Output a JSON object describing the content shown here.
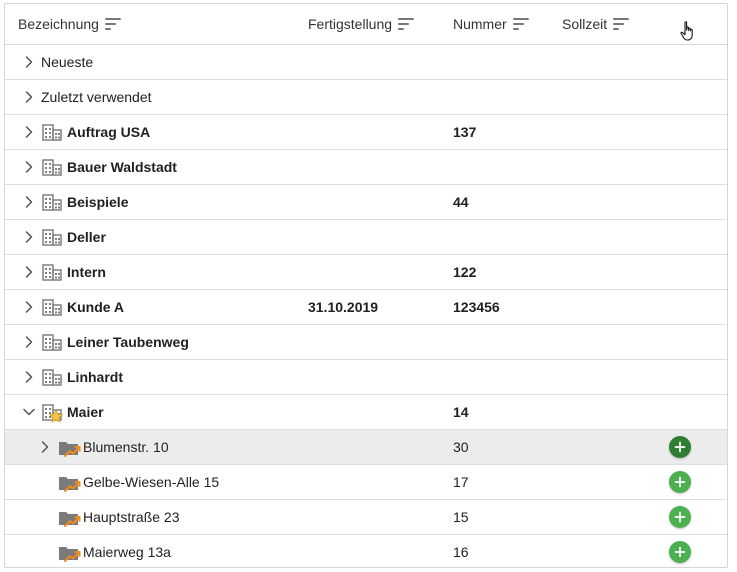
{
  "columns": [
    {
      "key": "bezeichnung",
      "label": "Bezeichnung"
    },
    {
      "key": "fertigstellung",
      "label": "Fertigstellung"
    },
    {
      "key": "nummer",
      "label": "Nummer"
    },
    {
      "key": "sollzeit",
      "label": "Sollzeit"
    }
  ],
  "rows": [
    {
      "id": "neueste",
      "name": "Neueste",
      "level": 0,
      "expand": "collapsed",
      "icon": "none",
      "bold": false,
      "date": "",
      "number": "",
      "add": false
    },
    {
      "id": "zuletzt",
      "name": "Zuletzt verwendet",
      "level": 0,
      "expand": "collapsed",
      "icon": "none",
      "bold": false,
      "date": "",
      "number": "",
      "add": false
    },
    {
      "id": "auftrag-usa",
      "name": "Auftrag USA",
      "level": 0,
      "expand": "collapsed",
      "icon": "building-icon",
      "bold": true,
      "date": "",
      "number": "137",
      "add": false
    },
    {
      "id": "bauer-waldstadt",
      "name": "Bauer Waldstadt",
      "level": 0,
      "expand": "collapsed",
      "icon": "building-icon",
      "bold": true,
      "date": "",
      "number": "",
      "add": false
    },
    {
      "id": "beispiele",
      "name": "Beispiele",
      "level": 0,
      "expand": "collapsed",
      "icon": "building-icon",
      "bold": true,
      "date": "",
      "number": "44",
      "add": false
    },
    {
      "id": "deller",
      "name": "Deller",
      "level": 0,
      "expand": "collapsed",
      "icon": "building-icon",
      "bold": true,
      "date": "",
      "number": "",
      "add": false
    },
    {
      "id": "intern",
      "name": "Intern",
      "level": 0,
      "expand": "collapsed",
      "icon": "building-icon",
      "bold": true,
      "date": "",
      "number": "122",
      "add": false
    },
    {
      "id": "kunde-a",
      "name": "Kunde A",
      "level": 0,
      "expand": "collapsed",
      "icon": "building-icon",
      "bold": true,
      "date": "31.10.2019",
      "number": "123456",
      "add": false
    },
    {
      "id": "leiner",
      "name": "Leiner Taubenweg",
      "level": 0,
      "expand": "collapsed",
      "icon": "building-icon",
      "bold": true,
      "date": "",
      "number": "",
      "add": false
    },
    {
      "id": "linhardt",
      "name": "Linhardt",
      "level": 0,
      "expand": "collapsed",
      "icon": "building-icon",
      "bold": true,
      "date": "",
      "number": "",
      "add": false
    },
    {
      "id": "maier",
      "name": "Maier",
      "level": 0,
      "expand": "expanded",
      "icon": "building-star-icon",
      "bold": true,
      "date": "",
      "number": "14",
      "add": false
    },
    {
      "id": "blumenstr",
      "name": "Blumenstr. 10",
      "level": 1,
      "expand": "collapsed",
      "icon": "project-folder-icon",
      "bold": false,
      "date": "",
      "number": "30",
      "add": true,
      "hover": true
    },
    {
      "id": "gelbe-wiesen",
      "name": "Gelbe-Wiesen-Alle 15",
      "level": 1,
      "expand": "none",
      "icon": "project-folder-icon",
      "bold": false,
      "date": "",
      "number": "17",
      "add": true
    },
    {
      "id": "hauptstrasse",
      "name": "Hauptstraße 23",
      "level": 1,
      "expand": "none",
      "icon": "project-folder-icon",
      "bold": false,
      "date": "",
      "number": "15",
      "add": true
    },
    {
      "id": "maierweg",
      "name": "Maierweg 13a",
      "level": 1,
      "expand": "none",
      "icon": "project-folder-icon",
      "bold": false,
      "date": "",
      "number": "16",
      "add": true
    }
  ],
  "colors": {
    "add_button": "#4caf50",
    "add_button_hover": "#2e7d32",
    "row_hover": "#ececec",
    "star": "#f6c343",
    "folder": "#7a7a7a",
    "folder_arrow": "#ef8a1e",
    "building": "#808080"
  }
}
